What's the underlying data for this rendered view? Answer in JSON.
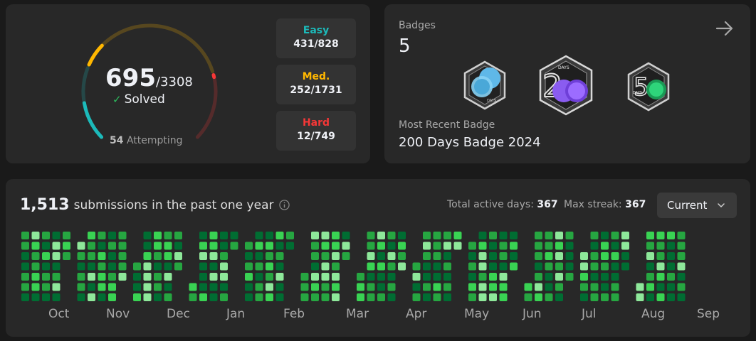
{
  "progress": {
    "solved": "695",
    "total": "/3308",
    "solved_label": "Solved",
    "attempting_count": "54",
    "attempting_label": "Attempting",
    "ring_colors": {
      "easy": "#1cbaba",
      "medium": "#ffb700",
      "hard": "#f63737"
    },
    "difficulties": {
      "easy": {
        "label": "Easy",
        "value": "431/828",
        "solved": 431,
        "total": 828
      },
      "medium": {
        "label": "Med.",
        "value": "252/1731",
        "solved": 252,
        "total": 1731
      },
      "hard": {
        "label": "Hard",
        "value": "12/749",
        "solved": 12,
        "total": 749
      }
    }
  },
  "badges": {
    "title": "Badges",
    "count": "5",
    "arrow_icon": "arrow-right-icon",
    "items": [
      {
        "icon": "annual-badge-icon"
      },
      {
        "icon": "200-days-badge-icon",
        "text": "DAYS"
      },
      {
        "icon": "50-days-badge-icon",
        "text": "DAYS"
      }
    ],
    "recent_label": "Most Recent Badge",
    "recent_name": "200 Days Badge 2024"
  },
  "submissions": {
    "count": "1,513",
    "label": "submissions in the past one year",
    "active_label": "Total active days:",
    "active_value": "367",
    "streak_label": "Max streak:",
    "streak_value": "367",
    "selector": "Current",
    "months": [
      "Oct",
      "Nov",
      "Dec",
      "Jan",
      "Feb",
      "Mar",
      "Apr",
      "May",
      "Jun",
      "Jul",
      "Aug",
      "Sep"
    ],
    "heat_colors": [
      "#0e4429",
      "#006d32",
      "#26a641",
      "#39d353",
      "#8ee89a"
    ]
  }
}
